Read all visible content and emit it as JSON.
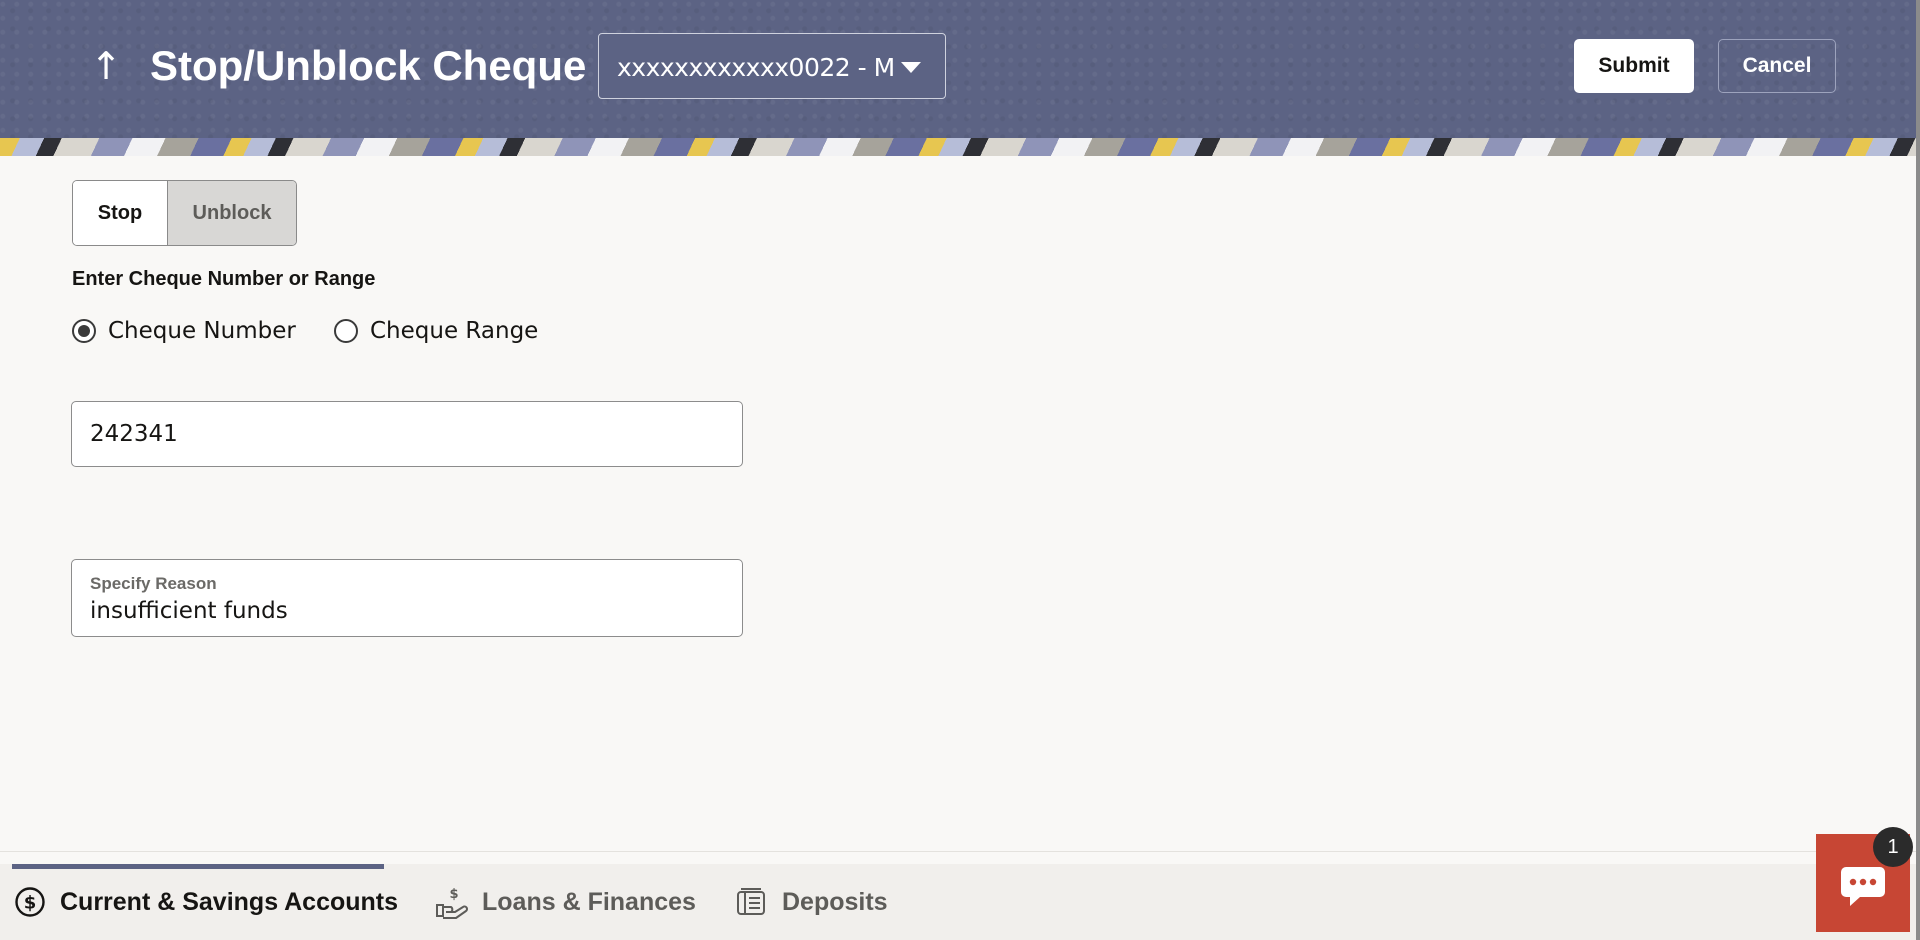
{
  "header": {
    "back_glyph": "↑",
    "title": "Stop/Unblock Cheque",
    "account_value": "xxxxxxxxxxxx0022 - M",
    "submit_label": "Submit",
    "cancel_label": "Cancel"
  },
  "segmented": {
    "options": [
      {
        "label": "Stop",
        "selected": true
      },
      {
        "label": "Unblock",
        "selected": false
      }
    ]
  },
  "form": {
    "section_label": "Enter Cheque Number or Range",
    "radio_options": [
      {
        "label": "Cheque Number",
        "checked": true
      },
      {
        "label": "Cheque Range",
        "checked": false
      }
    ],
    "cheque_number_value": "242341",
    "reason_label": "Specify Reason",
    "reason_value": "insufficient funds"
  },
  "bottom_tabs": [
    {
      "label": "Current & Savings Accounts",
      "icon": "dollar-circle-icon",
      "active": true
    },
    {
      "label": "Loans & Finances",
      "icon": "hand-dollar-icon",
      "active": false
    },
    {
      "label": "Deposits",
      "icon": "deposit-icon",
      "active": false
    }
  ],
  "chat": {
    "badge_count": "1",
    "icon": "chat-bubble-icon"
  },
  "colors": {
    "header_bg": "#5c6384",
    "chat_bg": "#c74634",
    "active_tab_text": "#161513",
    "inactive_tab_text": "#5d5c59"
  }
}
